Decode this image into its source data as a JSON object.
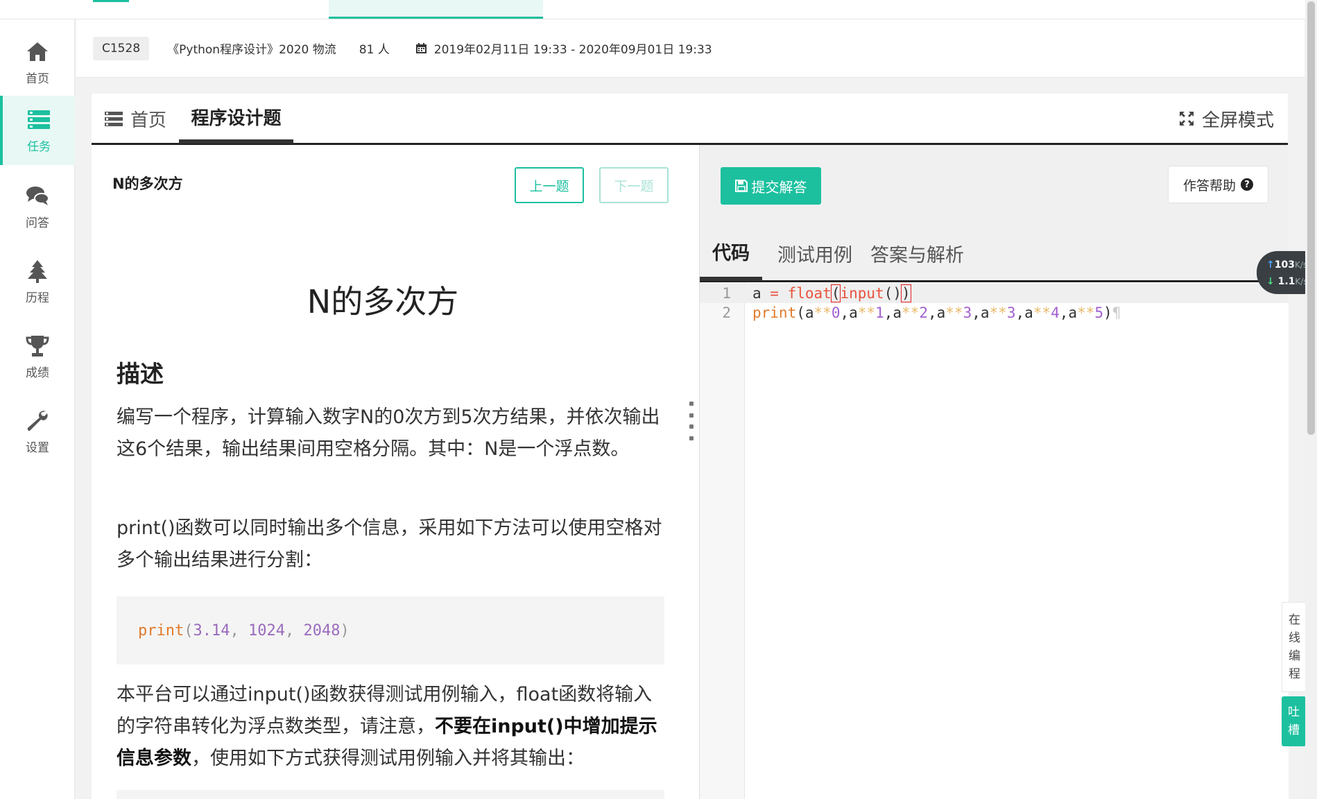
{
  "colors": {
    "accent": "#1cc09f",
    "dark": "#222222"
  },
  "sidebar": {
    "items": [
      {
        "label": "首页",
        "icon": "home-icon"
      },
      {
        "label": "任务",
        "icon": "tasks-icon",
        "active": true
      },
      {
        "label": "问答",
        "icon": "chat-icon"
      },
      {
        "label": "历程",
        "icon": "tree-icon"
      },
      {
        "label": "成绩",
        "icon": "trophy-icon"
      },
      {
        "label": "设置",
        "icon": "wrench-icon"
      }
    ]
  },
  "course": {
    "code": "C1528",
    "name": "《Python程序设计》2020 物流",
    "count": "81 人",
    "date": "2019年02月11日 19:33 - 2020年09月01日 19:33"
  },
  "tabs": {
    "home": "首页",
    "program": "程序设计题",
    "fullscreen": "全屏模式"
  },
  "problem": {
    "head": "N的多次方",
    "prev": "上一题",
    "next": "下一题",
    "title": "N的多次方",
    "section": "描述",
    "p1": "编写一个程序，计算输入数字N的0次方到5次方结果，并依次输出这6个结果，输出结果间用空格分隔。其中：N是一个浮点数。",
    "p2": "print()函数可以同时输出多个信息，采用如下方法可以使用空格对多个输出结果进行分割：",
    "code_fn": "print",
    "code_open": "(",
    "code_n1": "3.14",
    "code_c1": ", ",
    "code_n2": "1024",
    "code_c2": ", ",
    "code_n3": "2048",
    "code_close": ")",
    "p3a": "本平台可以通过input()函数获得测试用例输入，float函数将输入的字符串转化为浮点数类型，请注意，",
    "p3b": "不要在input()中增加提示信息参数",
    "p3c": "，使用如下方式获得测试用例输入并将其输出："
  },
  "editor": {
    "submit": "提交解答",
    "help": "作答帮助",
    "help_q": "?",
    "tab_code": "代码",
    "tab_test": "测试用例",
    "tab_answer": "答案与解析",
    "line1_no": "1",
    "line2_no": "2"
  },
  "speed": {
    "up_val": "103",
    "up_unit": "K/s",
    "down_val": "1.1",
    "down_unit": "K/s"
  },
  "floating": {
    "online_chars": [
      "在",
      "线",
      "编",
      "程"
    ],
    "feedback_chars": [
      "吐",
      "槽"
    ]
  }
}
